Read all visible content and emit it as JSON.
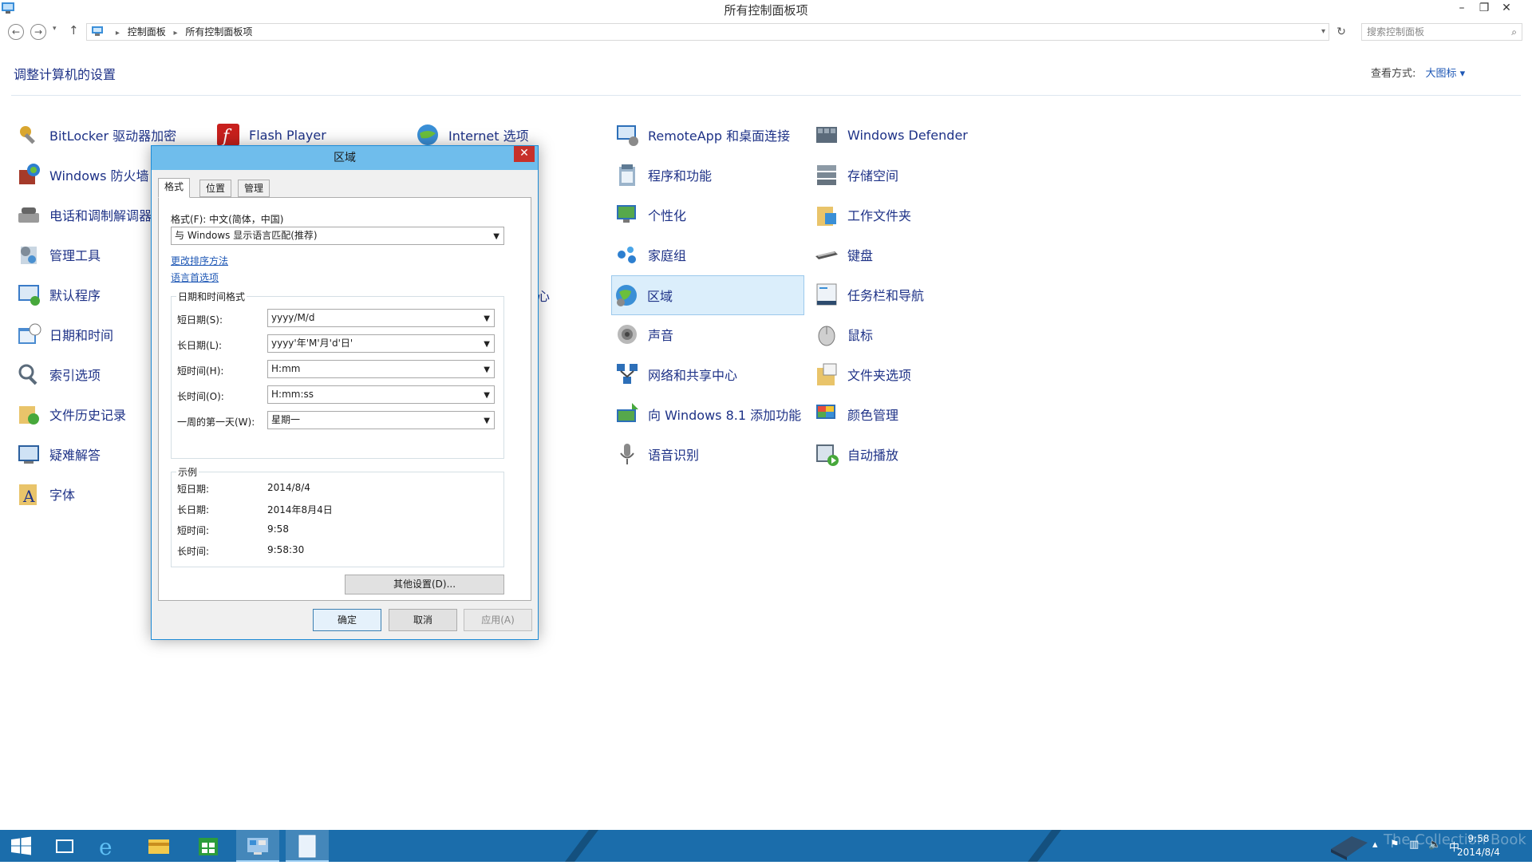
{
  "window": {
    "title": "所有控制面板项",
    "minimize_glyph": "–",
    "restore_glyph": "❐",
    "close_glyph": "✕"
  },
  "address": {
    "crumbs": [
      "控制面板",
      "所有控制面板项"
    ],
    "search_placeholder": "搜索控制面板"
  },
  "header": {
    "title": "调整计算机的设置",
    "viewby_label": "查看方式:",
    "viewby_value": "大图标 ▾"
  },
  "items": {
    "col1": [
      "BitLocker 驱动器加密",
      "Windows 防火墙",
      "电话和调制解调器",
      "管理工具",
      "默认程序",
      "日期和时间",
      "索引选项",
      "文件历史记录",
      "疑难解答",
      "字体"
    ],
    "col2_visible": [
      "Flash Player"
    ],
    "col3_visible": [
      "Internet 选项"
    ],
    "col3_partial": "心",
    "col4": [
      "RemoteApp 和桌面连接",
      "程序和功能",
      "个性化",
      "家庭组",
      "区域",
      "声音",
      "网络和共享中心",
      "向 Windows 8.1 添加功能",
      "语音识别"
    ],
    "col5": [
      "Windows Defender",
      "存储空间",
      "工作文件夹",
      "键盘",
      "任务栏和导航",
      "鼠标",
      "文件夹选项",
      "颜色管理",
      "自动播放"
    ],
    "selected": "区域"
  },
  "dialog": {
    "title": "区域",
    "tabs": [
      "格式",
      "位置",
      "管理"
    ],
    "format_label": "格式(F): 中文(简体，中国)",
    "format_value": "与 Windows 显示语言匹配(推荐)",
    "link_sort": "更改排序方法",
    "link_lang": "语言首选项",
    "dt_group_title": "日期和时间格式",
    "fields": [
      {
        "label": "短日期(S):",
        "value": "yyyy/M/d"
      },
      {
        "label": "长日期(L):",
        "value": "yyyy'年'M'月'd'日'"
      },
      {
        "label": "短时间(H):",
        "value": "H:mm"
      },
      {
        "label": "长时间(O):",
        "value": "H:mm:ss"
      },
      {
        "label": "一周的第一天(W):",
        "value": "星期一"
      }
    ],
    "example_title": "示例",
    "examples": [
      {
        "label": "短日期:",
        "value": "2014/8/4"
      },
      {
        "label": "长日期:",
        "value": "2014年8月4日"
      },
      {
        "label": "短时间:",
        "value": "9:58"
      },
      {
        "label": "长时间:",
        "value": "9:58:30"
      }
    ],
    "other_settings": "其他设置(D)...",
    "ok": "确定",
    "cancel": "取消",
    "apply": "应用(A)"
  },
  "taskbar": {
    "time": "9:58",
    "date": "2014/8/4",
    "ime": "中",
    "watermark": "The Collection Book"
  },
  "colors": {
    "link_blue": "#1e3287",
    "taskbar": "#1b6dab",
    "selection": "#dbeefb",
    "dialog_title": "#6fbdec"
  }
}
